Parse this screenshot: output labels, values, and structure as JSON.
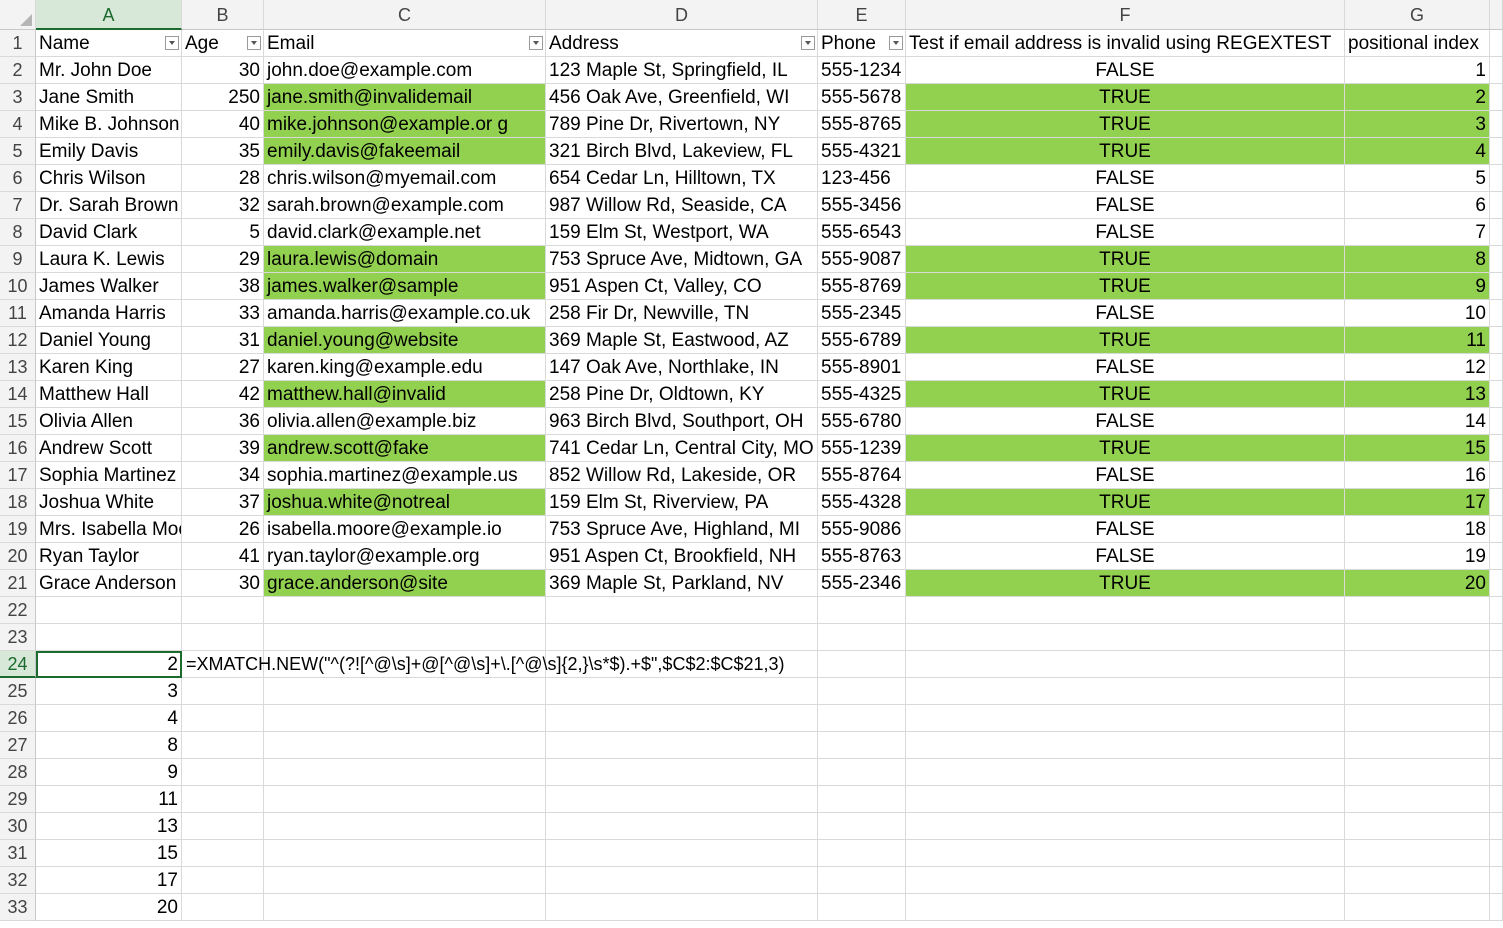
{
  "columns": [
    "A",
    "B",
    "C",
    "D",
    "E",
    "F",
    "G"
  ],
  "active_column": "A",
  "active_row": "24",
  "header_row": [
    "Name",
    "Age",
    "Email",
    "Address",
    "Phone",
    "Test if email address is invalid using REGEXTEST",
    "positional index"
  ],
  "rows": [
    {
      "n": "2",
      "a": "Mr. John Doe",
      "b": "30",
      "c": "john.doe@example.com",
      "d": "123 Maple St, Springfield, IL",
      "e": "555-1234",
      "f": "FALSE",
      "g": "1",
      "hl": false
    },
    {
      "n": "3",
      "a": "Jane Smith",
      "b": "250",
      "c": "jane.smith@invalidemail",
      "d": "456 Oak Ave, Greenfield, WI",
      "e": "555-5678",
      "f": "TRUE",
      "g": "2",
      "hl": true
    },
    {
      "n": "4",
      "a": "Mike B. Johnson",
      "b": "40",
      "c": "mike.johnson@example.or g",
      "d": "789 Pine Dr, Rivertown, NY",
      "e": "555-8765",
      "f": "TRUE",
      "g": "3",
      "hl": true
    },
    {
      "n": "5",
      "a": "Emily Davis",
      "b": "35",
      "c": "emily.davis@fakeemail",
      "d": "321 Birch Blvd, Lakeview, FL",
      "e": "555-4321",
      "f": "TRUE",
      "g": "4",
      "hl": true
    },
    {
      "n": "6",
      "a": "Chris Wilson",
      "b": "28",
      "c": "chris.wilson@myemail.com",
      "d": "654 Cedar Ln, Hilltown, TX",
      "e": "123-456",
      "f": "FALSE",
      "g": "5",
      "hl": false
    },
    {
      "n": "7",
      "a": "Dr. Sarah Brown",
      "b": "32",
      "c": "sarah.brown@example.com",
      "d": "987 Willow Rd, Seaside, CA",
      "e": "555-3456",
      "f": "FALSE",
      "g": "6",
      "hl": false
    },
    {
      "n": "8",
      "a": "David Clark",
      "b": "5",
      "c": "david.clark@example.net",
      "d": "159 Elm St, Westport, WA",
      "e": "555-6543",
      "f": "FALSE",
      "g": "7",
      "hl": false
    },
    {
      "n": "9",
      "a": "Laura K. Lewis",
      "b": "29",
      "c": "laura.lewis@domain",
      "d": "753 Spruce Ave, Midtown, GA",
      "e": "555-9087",
      "f": "TRUE",
      "g": "8",
      "hl": true
    },
    {
      "n": "10",
      "a": "James Walker",
      "b": "38",
      "c": "james.walker@sample",
      "d": "951 Aspen Ct, Valley, CO",
      "e": "555-8769",
      "f": "TRUE",
      "g": "9",
      "hl": true
    },
    {
      "n": "11",
      "a": "Amanda Harris",
      "b": "33",
      "c": "amanda.harris@example.co.uk",
      "d": "258 Fir Dr, Newville, TN",
      "e": "555-2345",
      "f": "FALSE",
      "g": "10",
      "hl": false
    },
    {
      "n": "12",
      "a": "Daniel Young",
      "b": "31",
      "c": "daniel.young@website",
      "d": "369 Maple St, Eastwood, AZ",
      "e": "555-6789",
      "f": "TRUE",
      "g": "11",
      "hl": true
    },
    {
      "n": "13",
      "a": "Karen King",
      "b": "27",
      "c": "karen.king@example.edu",
      "d": "147 Oak Ave, Northlake, IN",
      "e": "555-8901",
      "f": "FALSE",
      "g": "12",
      "hl": false
    },
    {
      "n": "14",
      "a": "Matthew Hall",
      "b": "42",
      "c": "matthew.hall@invalid",
      "d": "258 Pine Dr, Oldtown, KY",
      "e": "555-4325",
      "f": "TRUE",
      "g": "13",
      "hl": true
    },
    {
      "n": "15",
      "a": "Olivia Allen",
      "b": "36",
      "c": "olivia.allen@example.biz",
      "d": "963 Birch Blvd, Southport, OH",
      "e": "555-6780",
      "f": "FALSE",
      "g": "14",
      "hl": false
    },
    {
      "n": "16",
      "a": "Andrew Scott",
      "b": "39",
      "c": "andrew.scott@fake",
      "d": "741 Cedar Ln, Central City, MO",
      "e": "555-1239",
      "f": "TRUE",
      "g": "15",
      "hl": true
    },
    {
      "n": "17",
      "a": "Sophia Martinez",
      "b": "34",
      "c": "sophia.martinez@example.us",
      "d": "852 Willow Rd, Lakeside, OR",
      "e": "555-8764",
      "f": "FALSE",
      "g": "16",
      "hl": false
    },
    {
      "n": "18",
      "a": "Joshua White",
      "b": "37",
      "c": "joshua.white@notreal",
      "d": "159 Elm St, Riverview, PA",
      "e": "555-4328",
      "f": "TRUE",
      "g": "17",
      "hl": true
    },
    {
      "n": "19",
      "a": "Mrs. Isabella Moore",
      "b": "26",
      "c": "isabella.moore@example.io",
      "d": "753 Spruce Ave, Highland, MI",
      "e": "555-9086",
      "f": "FALSE",
      "g": "18",
      "hl": false
    },
    {
      "n": "20",
      "a": "Ryan Taylor",
      "b": "41",
      "c": "ryan.taylor@example.org",
      "d": "951 Aspen Ct, Brookfield, NH",
      "e": "555-8763",
      "f": "FALSE",
      "g": "19",
      "hl": false
    },
    {
      "n": "21",
      "a": "Grace Anderson",
      "b": "30",
      "c": "grace.anderson@site",
      "d": "369 Maple St, Parkland, NV",
      "e": "555-2346",
      "f": "TRUE",
      "g": "20",
      "hl": true
    }
  ],
  "empty_rows": [
    "22",
    "23"
  ],
  "spill_rows": [
    {
      "n": "24",
      "v": "2"
    },
    {
      "n": "25",
      "v": "3"
    },
    {
      "n": "26",
      "v": "4"
    },
    {
      "n": "27",
      "v": "8"
    },
    {
      "n": "28",
      "v": "9"
    },
    {
      "n": "29",
      "v": "11"
    },
    {
      "n": "30",
      "v": "13"
    },
    {
      "n": "31",
      "v": "15"
    },
    {
      "n": "32",
      "v": "17"
    },
    {
      "n": "33",
      "v": "20"
    }
  ],
  "formula_text": "=XMATCH.NEW(\"^(?![^@\\s]+@[^@\\s]+\\.[^@\\s]{2,}\\s*$).+$\",$C$2:$C$21,3)",
  "colors": {
    "highlight": "#92d050",
    "selection": "#1b6b2f",
    "header_bg": "#f3f3f3",
    "gridline": "#d9d9d9"
  }
}
